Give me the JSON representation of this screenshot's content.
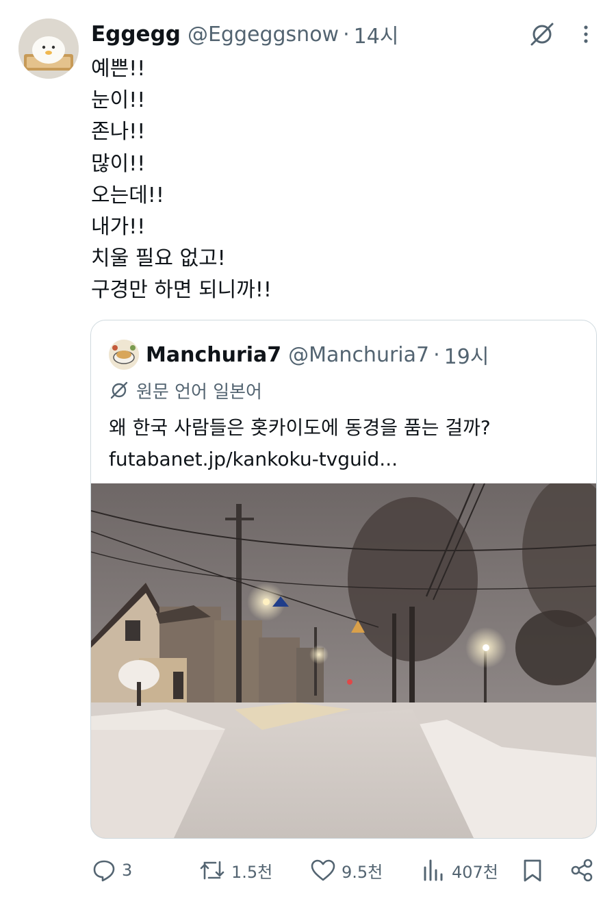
{
  "tweet": {
    "display_name": "Eggegg",
    "handle": "@Eggeggsnow",
    "separator": "·",
    "time": "14시",
    "lines": [
      "예쁜!!",
      "눈이!!",
      "존나!!",
      "많이!!",
      "오는데!!",
      "내가!!",
      "치울 필요 없고!",
      "구경만 하면 되니까!!"
    ]
  },
  "quote": {
    "display_name": "Manchuria7",
    "handle": "@Manchuria7",
    "separator": "·",
    "time": "19시",
    "translate_label": "원문 언어 일본어",
    "text_line1": "왜 한국 사람들은 홋카이도에 동경을 품는 걸까?",
    "text_line2": "futabanet.jp/kankoku-tvguid..."
  },
  "actions": {
    "replies": "3",
    "retweets": "1.5천",
    "likes": "9.5천",
    "views": "407천"
  },
  "icons": [
    "translate-icon",
    "more-icon",
    "reply-icon",
    "retweet-icon",
    "like-icon",
    "views-icon",
    "bookmark-icon",
    "share-icon"
  ],
  "colors": {
    "text": "#0f1419",
    "secondary": "#536471",
    "border": "#cfd9de"
  }
}
